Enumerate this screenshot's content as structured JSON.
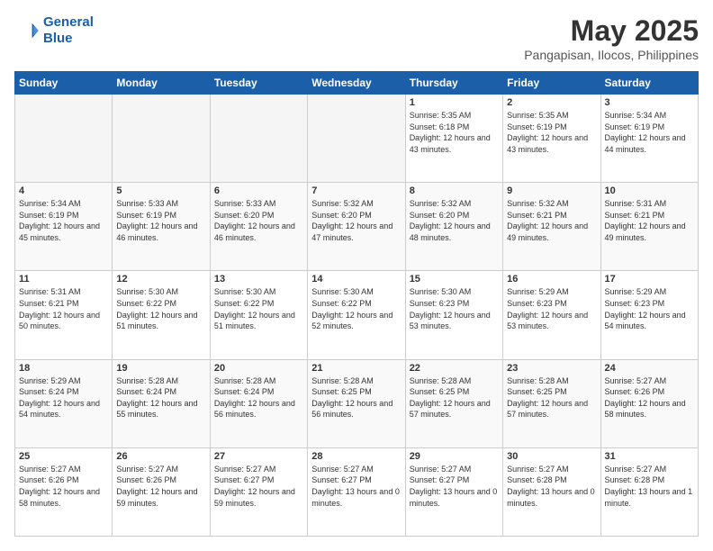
{
  "logo": {
    "line1": "General",
    "line2": "Blue"
  },
  "title": "May 2025",
  "subtitle": "Pangapisan, Ilocos, Philippines",
  "weekdays": [
    "Sunday",
    "Monday",
    "Tuesday",
    "Wednesday",
    "Thursday",
    "Friday",
    "Saturday"
  ],
  "weeks": [
    [
      {
        "day": "",
        "empty": true
      },
      {
        "day": "",
        "empty": true
      },
      {
        "day": "",
        "empty": true
      },
      {
        "day": "",
        "empty": true
      },
      {
        "day": "1",
        "rise": "5:35 AM",
        "set": "6:18 PM",
        "daylight": "12 hours and 43 minutes."
      },
      {
        "day": "2",
        "rise": "5:35 AM",
        "set": "6:19 PM",
        "daylight": "12 hours and 43 minutes."
      },
      {
        "day": "3",
        "rise": "5:34 AM",
        "set": "6:19 PM",
        "daylight": "12 hours and 44 minutes."
      }
    ],
    [
      {
        "day": "4",
        "rise": "5:34 AM",
        "set": "6:19 PM",
        "daylight": "12 hours and 45 minutes."
      },
      {
        "day": "5",
        "rise": "5:33 AM",
        "set": "6:19 PM",
        "daylight": "12 hours and 46 minutes."
      },
      {
        "day": "6",
        "rise": "5:33 AM",
        "set": "6:20 PM",
        "daylight": "12 hours and 46 minutes."
      },
      {
        "day": "7",
        "rise": "5:32 AM",
        "set": "6:20 PM",
        "daylight": "12 hours and 47 minutes."
      },
      {
        "day": "8",
        "rise": "5:32 AM",
        "set": "6:20 PM",
        "daylight": "12 hours and 48 minutes."
      },
      {
        "day": "9",
        "rise": "5:32 AM",
        "set": "6:21 PM",
        "daylight": "12 hours and 49 minutes."
      },
      {
        "day": "10",
        "rise": "5:31 AM",
        "set": "6:21 PM",
        "daylight": "12 hours and 49 minutes."
      }
    ],
    [
      {
        "day": "11",
        "rise": "5:31 AM",
        "set": "6:21 PM",
        "daylight": "12 hours and 50 minutes."
      },
      {
        "day": "12",
        "rise": "5:30 AM",
        "set": "6:22 PM",
        "daylight": "12 hours and 51 minutes."
      },
      {
        "day": "13",
        "rise": "5:30 AM",
        "set": "6:22 PM",
        "daylight": "12 hours and 51 minutes."
      },
      {
        "day": "14",
        "rise": "5:30 AM",
        "set": "6:22 PM",
        "daylight": "12 hours and 52 minutes."
      },
      {
        "day": "15",
        "rise": "5:30 AM",
        "set": "6:23 PM",
        "daylight": "12 hours and 53 minutes."
      },
      {
        "day": "16",
        "rise": "5:29 AM",
        "set": "6:23 PM",
        "daylight": "12 hours and 53 minutes."
      },
      {
        "day": "17",
        "rise": "5:29 AM",
        "set": "6:23 PM",
        "daylight": "12 hours and 54 minutes."
      }
    ],
    [
      {
        "day": "18",
        "rise": "5:29 AM",
        "set": "6:24 PM",
        "daylight": "12 hours and 54 minutes."
      },
      {
        "day": "19",
        "rise": "5:28 AM",
        "set": "6:24 PM",
        "daylight": "12 hours and 55 minutes."
      },
      {
        "day": "20",
        "rise": "5:28 AM",
        "set": "6:24 PM",
        "daylight": "12 hours and 56 minutes."
      },
      {
        "day": "21",
        "rise": "5:28 AM",
        "set": "6:25 PM",
        "daylight": "12 hours and 56 minutes."
      },
      {
        "day": "22",
        "rise": "5:28 AM",
        "set": "6:25 PM",
        "daylight": "12 hours and 57 minutes."
      },
      {
        "day": "23",
        "rise": "5:28 AM",
        "set": "6:25 PM",
        "daylight": "12 hours and 57 minutes."
      },
      {
        "day": "24",
        "rise": "5:27 AM",
        "set": "6:26 PM",
        "daylight": "12 hours and 58 minutes."
      }
    ],
    [
      {
        "day": "25",
        "rise": "5:27 AM",
        "set": "6:26 PM",
        "daylight": "12 hours and 58 minutes."
      },
      {
        "day": "26",
        "rise": "5:27 AM",
        "set": "6:26 PM",
        "daylight": "12 hours and 59 minutes."
      },
      {
        "day": "27",
        "rise": "5:27 AM",
        "set": "6:27 PM",
        "daylight": "12 hours and 59 minutes."
      },
      {
        "day": "28",
        "rise": "5:27 AM",
        "set": "6:27 PM",
        "daylight": "13 hours and 0 minutes."
      },
      {
        "day": "29",
        "rise": "5:27 AM",
        "set": "6:27 PM",
        "daylight": "13 hours and 0 minutes."
      },
      {
        "day": "30",
        "rise": "5:27 AM",
        "set": "6:28 PM",
        "daylight": "13 hours and 0 minutes."
      },
      {
        "day": "31",
        "rise": "5:27 AM",
        "set": "6:28 PM",
        "daylight": "13 hours and 1 minute."
      }
    ]
  ]
}
